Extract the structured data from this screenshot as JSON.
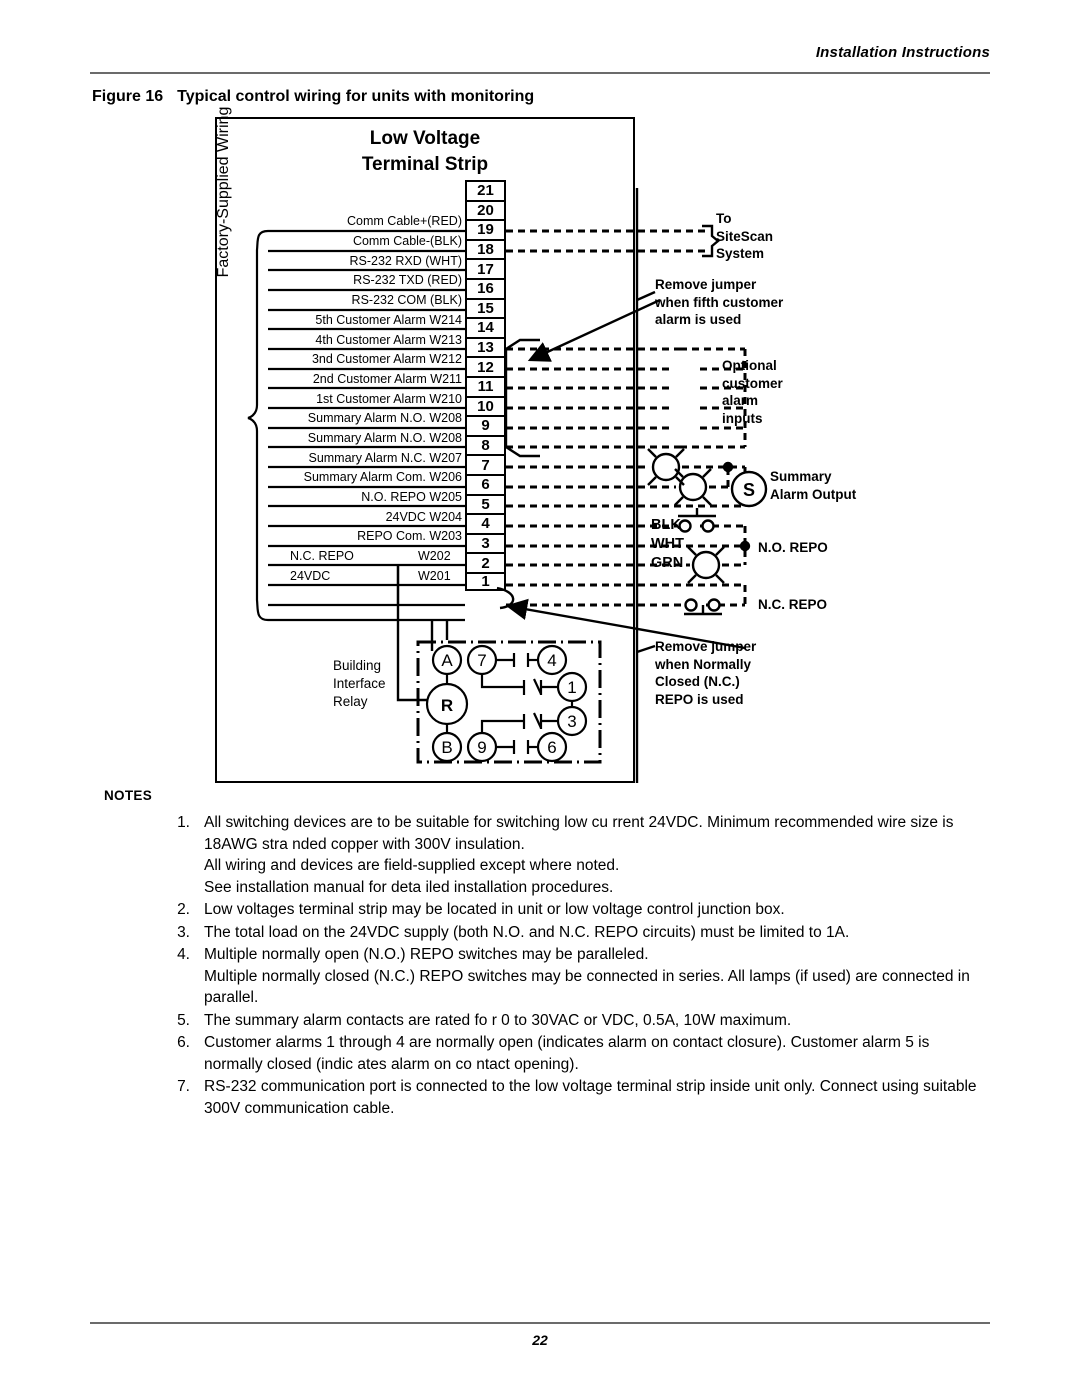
{
  "header": {
    "running_head": "Installation Instructions",
    "figure_number": "Figure 16",
    "figure_title": "Typical control wiring for units with monitoring"
  },
  "figure": {
    "title_line1": "Low Voltage",
    "title_line2": "Terminal Strip",
    "left_bracket_label": "Factory-Supplied Wiring",
    "terminals": [
      "21",
      "20",
      "19",
      "18",
      "17",
      "16",
      "15",
      "14",
      "13",
      "12",
      "11",
      "10",
      "9",
      "8",
      "7",
      "6",
      "5",
      "4",
      "3",
      "2",
      "1"
    ],
    "wire_labels": [
      {
        "terminal": "19",
        "text": "Comm Cable+(RED)"
      },
      {
        "terminal": "18",
        "text": "Comm Cable-(BLK)"
      },
      {
        "terminal": "17",
        "text": "RS-232 RXD (WHT)"
      },
      {
        "terminal": "16",
        "text": "RS-232 TXD (RED)"
      },
      {
        "terminal": "15",
        "text": "RS-232 COM (BLK)"
      },
      {
        "terminal": "14",
        "text": "5th Customer Alarm W214"
      },
      {
        "terminal": "13",
        "text": "4th Customer Alarm W213"
      },
      {
        "terminal": "12",
        "text": "3nd Customer Alarm W212"
      },
      {
        "terminal": "11",
        "text": "2nd Customer Alarm W211"
      },
      {
        "terminal": "10",
        "text": "1st Customer Alarm W210"
      },
      {
        "terminal": "9",
        "text": "Summary Alarm N.O. W208"
      },
      {
        "terminal": "8",
        "text": "Summary Alarm N.O. W208"
      },
      {
        "terminal": "7",
        "text": "Summary Alarm N.C. W207"
      },
      {
        "terminal": "6",
        "text": "Summary Alarm Com. W206"
      },
      {
        "terminal": "5",
        "text": "N.O. REPO W205"
      },
      {
        "terminal": "4",
        "text": "24VDC W204"
      },
      {
        "terminal": "3",
        "text": "REPO Com. W203"
      },
      {
        "terminal": "2",
        "text": "N.C. REPO"
      },
      {
        "terminal": "2b",
        "text": "W202"
      },
      {
        "terminal": "1",
        "text": "24VDC"
      },
      {
        "terminal": "1b",
        "text": "W201"
      }
    ],
    "annotations": {
      "sitescan": "To\nSiteScan\nSystem",
      "sitescan_l1": "To",
      "sitescan_l2": "SiteScan",
      "sitescan_l3": "System",
      "remove_jumper_fifth_l1": "Remove jumper",
      "remove_jumper_fifth_l2": "when fifth customer",
      "remove_jumper_fifth_l3": "alarm is used",
      "optional_l1": "Optional",
      "optional_l2": "customer",
      "optional_l3": "alarm",
      "optional_l4": "inputs",
      "summary_l1": "Summary",
      "summary_l2": "Alarm Output",
      "summary_symbol": "S",
      "no_repo": "N.O. REPO",
      "nc_repo": "N.C. REPO",
      "wire_blk": "BLK",
      "wire_wht": "WHT",
      "wire_grn": "GRN",
      "remove_jumper_nc_l1": "Remove jumper",
      "remove_jumper_nc_l2": "when Normally",
      "remove_jumper_nc_l3": "Closed (N.C.)",
      "remove_jumper_nc_l4": "REPO is used",
      "relay_l1": "Building",
      "relay_l2": "Interface",
      "relay_l3": "Relay",
      "relay_nodes": [
        "A",
        "7",
        "4",
        "R",
        "1",
        "3",
        "B",
        "9",
        "6"
      ]
    }
  },
  "notes": {
    "heading": "NOTES",
    "items": [
      {
        "number": "1.",
        "paragraphs": [
          "All switching devices are to be suitable    for switching low cu  rrent 24VDC. Minimum recommended wire size is 18AWG stra  nded copper with 300V insulation.",
          "All wiring and devices are field-supplied except where noted.",
          "See installation manual for deta    iled installation procedures."
        ]
      },
      {
        "number": "2.",
        "paragraphs": [
          "Low voltages terminal strip may be located in unit or low voltage control junction box."
        ]
      },
      {
        "number": "3.",
        "paragraphs": [
          "The total load on the 24VDC supply (both N.O. and N.C. REPO circuits) must be limited to 1A."
        ]
      },
      {
        "number": "4.",
        "paragraphs": [
          "Multiple normally open (N.O.) REPO switches may be paralleled.",
          "Multiple normally closed (N.C.) REPO switches     may be connected in series. All lamps (if used) are connected in parallel."
        ]
      },
      {
        "number": "5.",
        "paragraphs": [
          "The summary alarm contacts are rated fo   r 0 to 30VAC or VDC,  0.5A, 10W maximum."
        ]
      },
      {
        "number": "6.",
        "paragraphs": [
          "Customer alarms 1 through 4 are normally open    (indicates alarm on contact closure). Customer alarm 5 is normally closed (indic   ates alarm on co ntact opening)."
        ]
      },
      {
        "number": "7.",
        "paragraphs": [
          "RS-232 communication port is connected to the low voltage terminal strip inside unit only. Connect using suitable 300V communication cable."
        ]
      }
    ]
  },
  "footer": {
    "page_number": "22"
  }
}
